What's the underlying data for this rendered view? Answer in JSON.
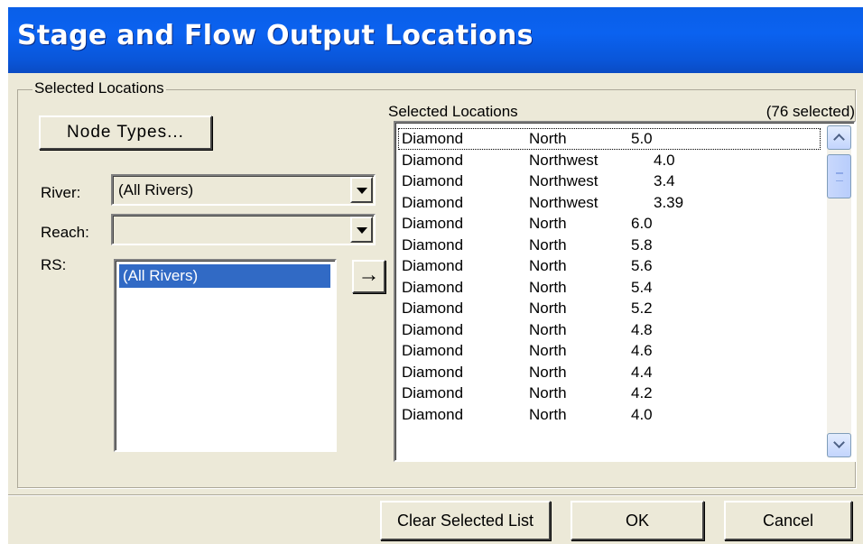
{
  "window": {
    "title": "Stage and Flow Output Locations"
  },
  "group": {
    "legend": "Selected Locations"
  },
  "left": {
    "node_types_label": "Node Types...",
    "river": {
      "label": "River:",
      "value": "(All Rivers)"
    },
    "reach": {
      "label": "Reach:",
      "value": ""
    },
    "rs": {
      "label": "RS:",
      "items": [
        "(All Rivers)"
      ]
    },
    "add_arrow": "→"
  },
  "selected": {
    "header": "Selected Locations",
    "count": "(76 selected)",
    "rows": [
      [
        "Diamond",
        "North",
        "5.0"
      ],
      [
        "Diamond",
        "Northwest",
        "4.0"
      ],
      [
        "Diamond",
        "Northwest",
        "3.4"
      ],
      [
        "Diamond",
        "Northwest",
        "3.39"
      ],
      [
        "Diamond",
        "North",
        "6.0"
      ],
      [
        "Diamond",
        "North",
        "5.8"
      ],
      [
        "Diamond",
        "North",
        "5.6"
      ],
      [
        "Diamond",
        "North",
        "5.4"
      ],
      [
        "Diamond",
        "North",
        "5.2"
      ],
      [
        "Diamond",
        "North",
        "4.8"
      ],
      [
        "Diamond",
        "North",
        "4.6"
      ],
      [
        "Diamond",
        "North",
        "4.4"
      ],
      [
        "Diamond",
        "North",
        "4.2"
      ],
      [
        "Diamond",
        "North",
        "4.0"
      ]
    ]
  },
  "buttons": {
    "clear": "Clear Selected List",
    "ok": "OK",
    "cancel": "Cancel"
  }
}
